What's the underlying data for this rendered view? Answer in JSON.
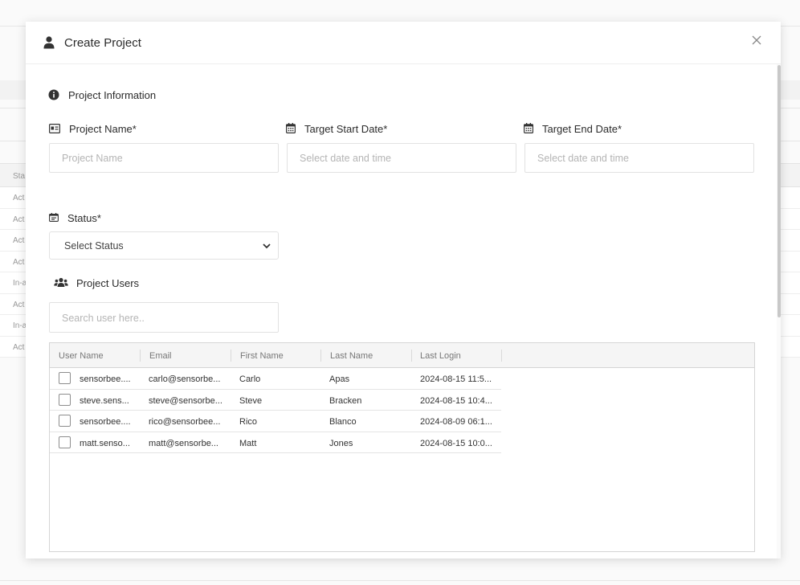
{
  "background": {
    "status_header": "Sta",
    "rows": [
      "Act",
      "Act",
      "Act",
      "Act",
      "In-a",
      "Act",
      "In-a",
      "Act"
    ]
  },
  "modal": {
    "title": "Create Project",
    "title_icon": "user-icon",
    "close_icon": "close-icon"
  },
  "project_info": {
    "heading": "Project Information",
    "heading_icon": "info-circle-icon",
    "project_name": {
      "label": "Project Name*",
      "icon": "id-card-icon",
      "placeholder": "Project Name",
      "value": ""
    },
    "start_date": {
      "label": "Target Start Date*",
      "icon": "calendar-icon",
      "placeholder": "Select date and time",
      "value": ""
    },
    "end_date": {
      "label": "Target End Date*",
      "icon": "calendar-icon",
      "placeholder": "Select date and time",
      "value": ""
    },
    "status": {
      "label": "Status*",
      "icon": "calendar-check-icon",
      "selected": "Select Status"
    }
  },
  "project_users": {
    "heading": "Project Users",
    "heading_icon": "users-icon",
    "search_placeholder": "Search user here..",
    "columns": [
      "User Name",
      "Email",
      "First Name",
      "Last Name",
      "Last Login"
    ],
    "rows": [
      {
        "user_name": "sensorbee....",
        "email": "carlo@sensorbe...",
        "first_name": "Carlo",
        "last_name": "Apas",
        "last_login": "2024-08-15 11:5..."
      },
      {
        "user_name": "steve.sens...",
        "email": "steve@sensorbe...",
        "first_name": "Steve",
        "last_name": "Bracken",
        "last_login": "2024-08-15 10:4..."
      },
      {
        "user_name": "sensorbee....",
        "email": "rico@sensorbee...",
        "first_name": "Rico",
        "last_name": "Blanco",
        "last_login": "2024-08-09 06:1..."
      },
      {
        "user_name": "matt.senso...",
        "email": "matt@sensorbe...",
        "first_name": "Matt",
        "last_name": "Jones",
        "last_login": "2024-08-15 10:0..."
      }
    ]
  },
  "colors": {
    "border": "#e2e2e2",
    "text": "#2b2b2b",
    "placeholder": "#b5b5b5",
    "grid_header_bg": "#f5f5f5"
  }
}
